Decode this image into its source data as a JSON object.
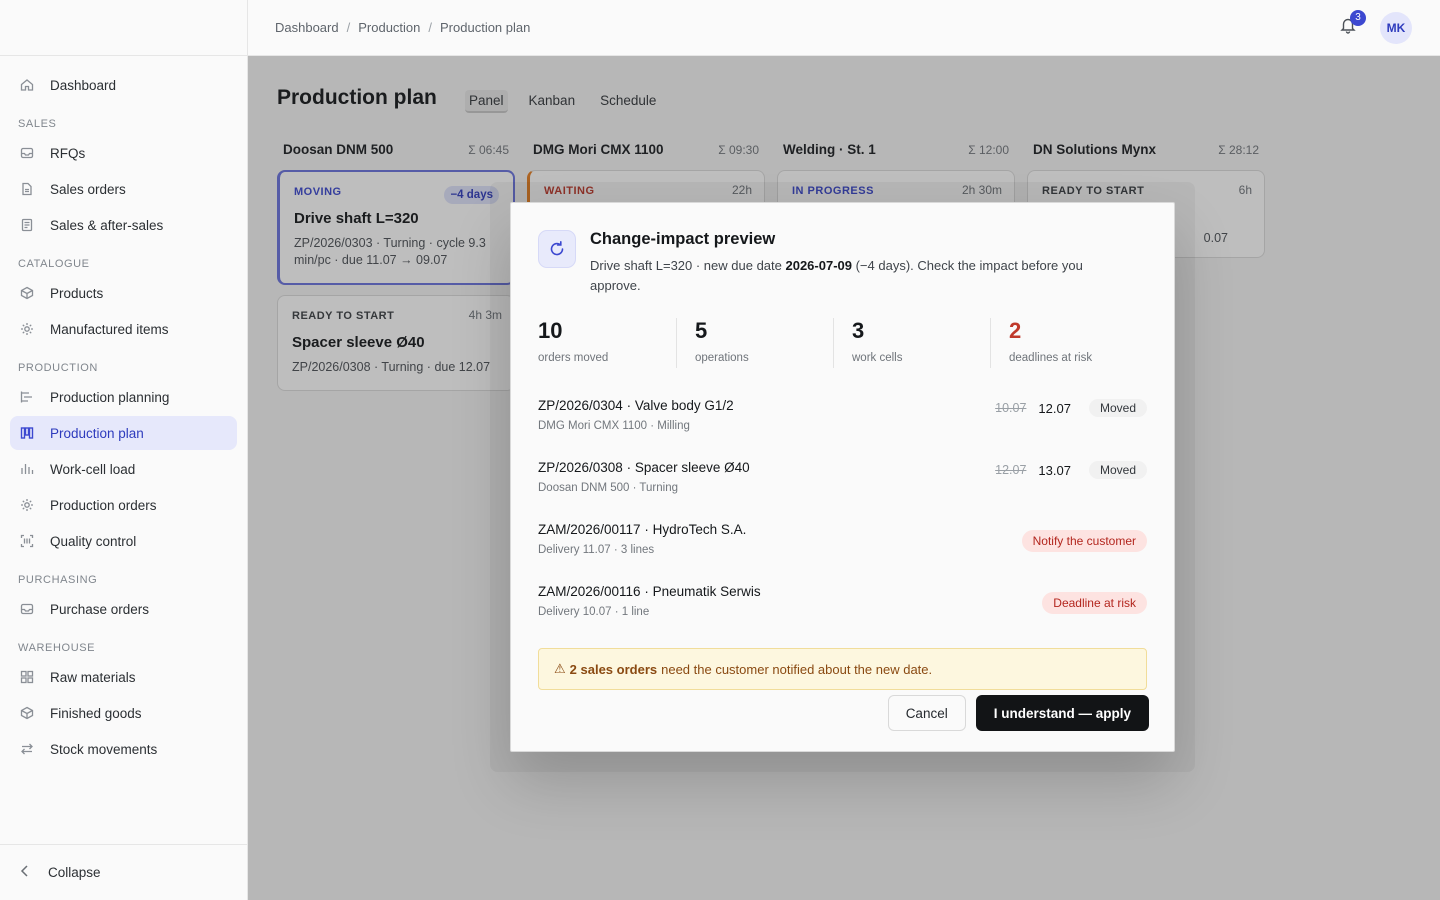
{
  "breadcrumb": [
    "Dashboard",
    "Production",
    "Production plan"
  ],
  "notifications": {
    "count": "3"
  },
  "user": {
    "initials": "MK"
  },
  "sidebar": {
    "top": [
      {
        "label": "Dashboard",
        "icon": "home-icon"
      }
    ],
    "sections": [
      {
        "title": "SALES",
        "items": [
          {
            "label": "RFQs",
            "icon": "inbox-icon"
          },
          {
            "label": "Sales orders",
            "icon": "document-icon"
          },
          {
            "label": "Sales & after-sales",
            "icon": "receipt-icon"
          }
        ]
      },
      {
        "title": "CATALOGUE",
        "items": [
          {
            "label": "Products",
            "icon": "box-icon"
          },
          {
            "label": "Manufactured items",
            "icon": "gear-icon"
          }
        ]
      },
      {
        "title": "PRODUCTION",
        "items": [
          {
            "label": "Production planning",
            "icon": "gantt-icon"
          },
          {
            "label": "Production plan",
            "icon": "kanban-icon",
            "active": true
          },
          {
            "label": "Work-cell load",
            "icon": "bar-chart-icon"
          },
          {
            "label": "Production orders",
            "icon": "gear-icon"
          },
          {
            "label": "Quality control",
            "icon": "scan-icon"
          }
        ]
      },
      {
        "title": "PURCHASING",
        "items": [
          {
            "label": "Purchase orders",
            "icon": "inbox-icon"
          }
        ]
      },
      {
        "title": "WAREHOUSE",
        "items": [
          {
            "label": "Raw materials",
            "icon": "grid-icon"
          },
          {
            "label": "Finished goods",
            "icon": "box-icon"
          },
          {
            "label": "Stock movements",
            "icon": "arrows-icon"
          }
        ]
      }
    ],
    "collapse_label": "Collapse"
  },
  "page": {
    "title": "Production plan",
    "tabs": [
      "Panel",
      "Kanban",
      "Schedule"
    ],
    "active_tab": "Panel"
  },
  "columns": [
    {
      "name": "Doosan DNM 500",
      "time": "Σ 06:45"
    },
    {
      "name": "DMG Mori CMX 1100",
      "time": "Σ 09:30"
    },
    {
      "name": "Welding · St. 1",
      "time": "Σ 12:00"
    },
    {
      "name": "DN Solutions Mynx",
      "time": "Σ 28:12"
    }
  ],
  "cards": {
    "c1": {
      "status": "MOVING",
      "badge": "−4 days",
      "title": "Drive shaft L=320",
      "meta": "ZP/2026/0303 · Turning · cycle 9.3 min/pc · due 11.07 → 09.07"
    },
    "c2": {
      "status": "READY TO START",
      "duration": "4h 3m",
      "title": "Spacer sleeve Ø40",
      "meta": "ZP/2026/0308 · Turning · due 12.07"
    },
    "c3": {
      "status": "WAITING",
      "duration": "22h"
    },
    "c4": {
      "status": "IN PROGRESS",
      "duration": "2h 30m"
    },
    "c5": {
      "status": "READY TO START",
      "duration": "6h",
      "meta_fragment": "0.07"
    }
  },
  "modal": {
    "title": "Change-impact preview",
    "desc_before": "Drive shaft L=320 · new due date ",
    "desc_date": "2026-07-09",
    "desc_after": " (−4 days). Check the impact before you approve.",
    "stats": [
      {
        "value": "10",
        "label": "orders moved"
      },
      {
        "value": "5",
        "label": "operations"
      },
      {
        "value": "3",
        "label": "work cells"
      },
      {
        "value": "2",
        "label": "deadlines at risk"
      }
    ],
    "rows": [
      {
        "title": "ZP/2026/0304 · Valve body G1/2",
        "sub": "DMG Mori CMX 1100 · Milling",
        "old_date": "10.07",
        "new_date": "12.07",
        "tag": "Moved"
      },
      {
        "title": "ZP/2026/0308 · Spacer sleeve Ø40",
        "sub": "Doosan DNM 500 · Turning",
        "old_date": "12.07",
        "new_date": "13.07",
        "tag": "Moved"
      },
      {
        "title": "ZAM/2026/00117 · HydroTech S.A.",
        "sub": "Delivery 11.07 · 3 lines",
        "tag": "Notify the customer"
      },
      {
        "title": "ZAM/2026/00116 · Pneumatik Serwis",
        "sub": "Delivery 10.07 · 1 line",
        "tag": "Deadline at risk"
      }
    ],
    "warning": {
      "icon": "⚠",
      "bold": "2 sales orders",
      "text": "need the customer notified about the new date."
    },
    "cancel_label": "Cancel",
    "apply_label": "I understand — apply"
  },
  "colors": {
    "accent": "#3c48d0",
    "danger": "#c0392b",
    "warning_bg": "#fdf7df"
  }
}
